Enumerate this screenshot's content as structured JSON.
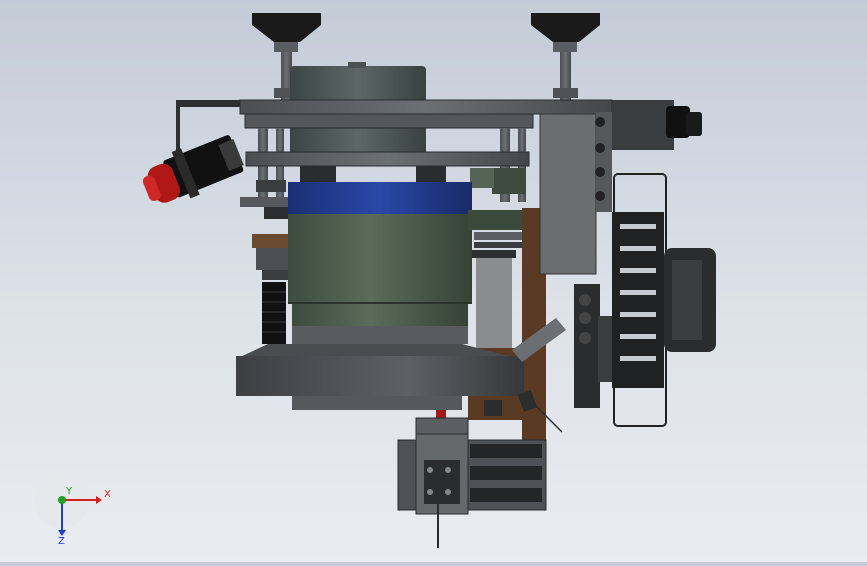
{
  "view": {
    "triad": {
      "x_label": "X",
      "y_label": "Y",
      "z_label": "Z"
    }
  },
  "colors": {
    "background_top": "#c3cbd6",
    "background_bottom": "#e9ecf0",
    "steel": "#5a5e62",
    "dark_steel": "#3b3e42",
    "cylinder_green": "#4a5a4a",
    "blue_band": "#1e3a8a",
    "wood_brown": "#5a3a22",
    "motor_red": "#b01818",
    "axis_x": "#d02020",
    "axis_y": "#20a020",
    "axis_z": "#2040d0"
  }
}
